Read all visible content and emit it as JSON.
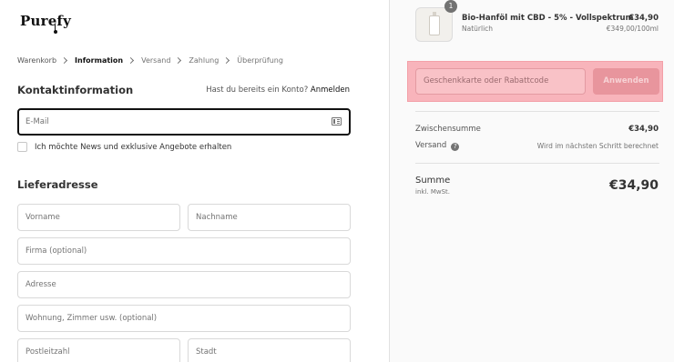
{
  "header": {
    "brand": "Purefy"
  },
  "breadcrumb": [
    {
      "label": "Warenkorb"
    },
    {
      "label": "Information"
    },
    {
      "label": "Versand"
    },
    {
      "label": "Zahlung"
    },
    {
      "label": "Überprüfung"
    }
  ],
  "contact": {
    "title": "Kontaktinformation",
    "login_prompt": "Hast du bereits ein Konto?",
    "login_link": "Anmelden",
    "email_placeholder": "E-Mail",
    "newsletter_label": "Ich möchte News und exklusive Angebote erhalten"
  },
  "shipping": {
    "title": "Lieferadresse",
    "first_name": "Vorname",
    "last_name": "Nachname",
    "company": "Firma (optional)",
    "address": "Adresse",
    "apartment": "Wohnung, Zimmer usw. (optional)",
    "postal_code": "Postleitzahl",
    "city": "Stadt"
  },
  "order": {
    "item": {
      "quantity": "1",
      "name": "Bio-Hanföl mit CBD - 5% - Vollspektrum",
      "variant": "Natürlich",
      "price": "€34,90",
      "unit_price": "€349,00/100ml"
    },
    "discount": {
      "placeholder": "Geschenkkarte oder Rabattcode",
      "apply_label": "Anwenden"
    },
    "subtotal_label": "Zwischensumme",
    "subtotal_value": "€34,90",
    "shipping_label": "Versand",
    "shipping_value": "Wird im nächsten Schritt berechnet",
    "total_label": "Summe",
    "total_sub": "inkl. MwSt.",
    "total_value": "€34,90"
  },
  "colors": {
    "highlight": "#f8b4bb",
    "apply_button": "#e8959d",
    "text": "#333333"
  }
}
